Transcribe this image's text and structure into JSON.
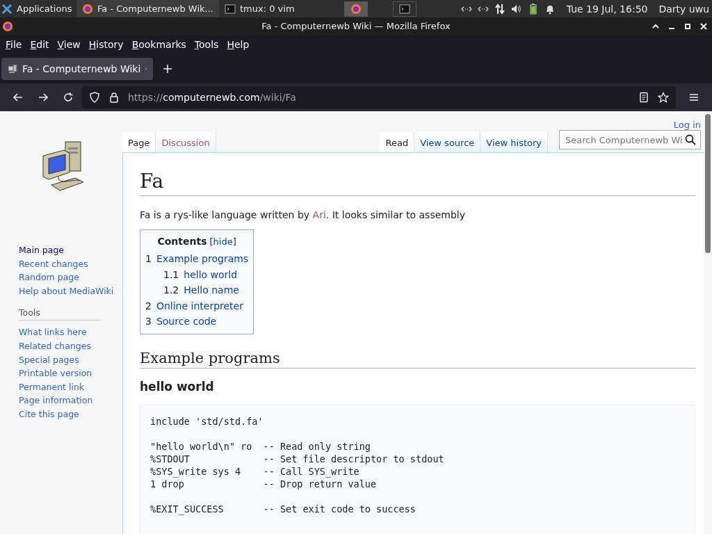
{
  "taskbar": {
    "apps_label": "Applications",
    "tasks": [
      {
        "label": "Fa - Computernewb Wik...",
        "kind": "browser",
        "selected": true
      },
      {
        "label": "tmux: 0 vim",
        "kind": "terminal",
        "selected": false
      }
    ],
    "workspaces": [
      {
        "kind": "browser",
        "selected": true
      },
      {
        "kind": "terminal",
        "selected": false
      }
    ],
    "clock": "Tue 19 Jul, 16:50",
    "user": "Darty uwu"
  },
  "window": {
    "title": "Fa - Computernewb Wiki — Mozilla Firefox"
  },
  "menu": [
    "File",
    "Edit",
    "View",
    "History",
    "Bookmarks",
    "Tools",
    "Help"
  ],
  "tabs": [
    {
      "label": "Fa - Computernewb Wiki",
      "selected": true
    }
  ],
  "address": {
    "scheme": "https://",
    "host": "computernewb.com",
    "path": "/wiki/Fa"
  },
  "wiki": {
    "login": "Log in",
    "nav": [
      {
        "label": "Main page",
        "visited": true
      },
      {
        "label": "Recent changes",
        "visited": false
      },
      {
        "label": "Random page",
        "visited": false
      },
      {
        "label": "Help about MediaWiki",
        "visited": false
      }
    ],
    "tools_heading": "Tools",
    "tools": [
      {
        "label": "What links here",
        "visited": false
      },
      {
        "label": "Related changes",
        "visited": false
      },
      {
        "label": "Special pages",
        "visited": false
      },
      {
        "label": "Printable version",
        "visited": false
      },
      {
        "label": "Permanent link",
        "visited": false
      },
      {
        "label": "Page information",
        "visited": false
      },
      {
        "label": "Cite this page",
        "visited": false
      }
    ],
    "left_tabs": [
      {
        "label": "Page",
        "selected": true,
        "exists": true
      },
      {
        "label": "Discussion",
        "selected": false,
        "exists": false
      }
    ],
    "right_tabs": [
      {
        "label": "Read",
        "selected": true
      },
      {
        "label": "View source",
        "selected": false
      },
      {
        "label": "View history",
        "selected": false
      }
    ],
    "search": {
      "placeholder": "Search Computernewb Wi"
    },
    "title": "Fa",
    "intro": {
      "before": "Fa is a rys-like language written by ",
      "link": "Ari",
      "after": ". It looks similar to assembly"
    },
    "toc": {
      "title": "Contents",
      "bracket_open": "[",
      "toggle": "hide",
      "bracket_close": "]",
      "items": [
        {
          "number": "1",
          "label": "Example programs",
          "children": [
            {
              "number": "1.1",
              "label": "hello world"
            },
            {
              "number": "1.2",
              "label": "Hello name"
            }
          ]
        },
        {
          "number": "2",
          "label": "Online interpreter"
        },
        {
          "number": "3",
          "label": "Source code"
        }
      ]
    },
    "section_heading": "Example programs",
    "subsection_heading": "hello world",
    "code": [
      [
        "include 'std/std.fa'"
      ],
      [
        "\"hello world\\n\" ro  -- Read only string",
        "%STDOUT             -- Set file descriptor to stdout",
        "%SYS_write sys 4    -- Call SYS_write",
        "1 drop              -- Drop return value"
      ],
      [
        "%EXIT_SUCCESS       -- Set exit code to success"
      ]
    ]
  }
}
